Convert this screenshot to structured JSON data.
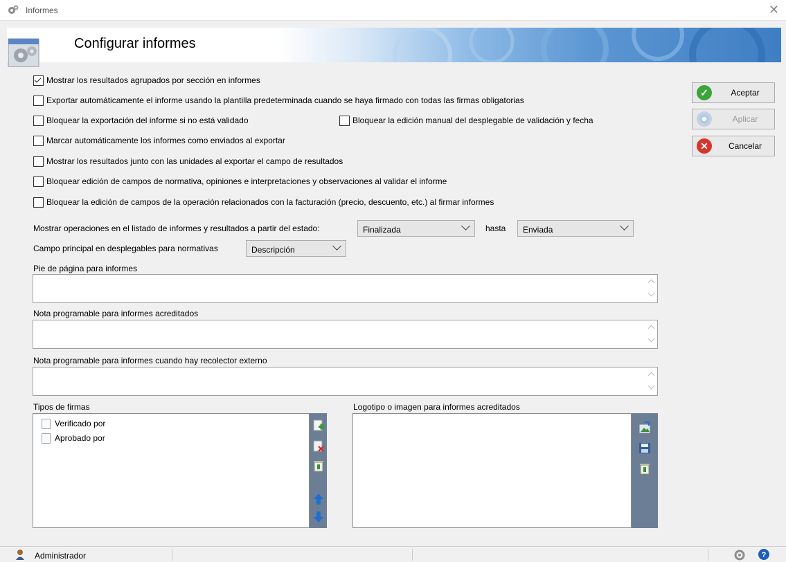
{
  "window": {
    "title": "Informes"
  },
  "banner": {
    "heading": "Configurar informes"
  },
  "options": [
    {
      "label": "Mostrar los resultados agrupados por sección en informes",
      "checked": true
    },
    {
      "label": "Exportar automáticamente el informe usando la plantilla predeterminada cuando se haya firmado con todas las firmas obligatorias",
      "checked": false
    },
    {
      "label": "Bloquear la exportación del informe si no está validado",
      "checked": false
    },
    {
      "label": "Bloquear la edición manual del desplegable de validación y fecha",
      "checked": false
    },
    {
      "label": "Marcar automáticamente los informes como enviados al exportar",
      "checked": false
    },
    {
      "label": "Mostrar los resultados junto con las unidades al exportar el campo de resultados",
      "checked": false
    },
    {
      "label": "Bloquear edición de campos de normativa, opiniones e interpretaciones y observaciones al validar el  informe",
      "checked": false
    },
    {
      "label": "Bloquear la edición de campos de la operación relacionados con la facturación (precio, descuento, etc.) al firmar informes",
      "checked": false
    }
  ],
  "status_filter": {
    "label": "Mostrar operaciones en el listado de informes y resultados a partir del estado:",
    "from_value": "Finalizada",
    "to_label": "hasta",
    "to_value": "Enviada"
  },
  "main_field": {
    "label": "Campo principal en desplegables para normativas",
    "value": "Descripción"
  },
  "footer_field": {
    "label": "Pie de página para informes",
    "value": ""
  },
  "accredited_note": {
    "label": "Nota programable para informes acreditados",
    "value": ""
  },
  "external_note": {
    "label": "Nota programable para informes cuando hay recolector externo",
    "value": ""
  },
  "signature_types": {
    "label": "Tipos de firmas",
    "items": [
      "Verificado por",
      "Aprobado por"
    ]
  },
  "logo": {
    "label": "Logotipo o imagen para informes acreditados"
  },
  "buttons": {
    "accept": "Aceptar",
    "apply": "Aplicar",
    "cancel": "Cancelar"
  },
  "status_bar": {
    "user": "Administrador"
  },
  "colors": {
    "accept_icon": "#3aa53a",
    "cancel_icon": "#d9342b",
    "toolstrip": "#6b7e96",
    "banner_blue": "#3e7ec3"
  }
}
